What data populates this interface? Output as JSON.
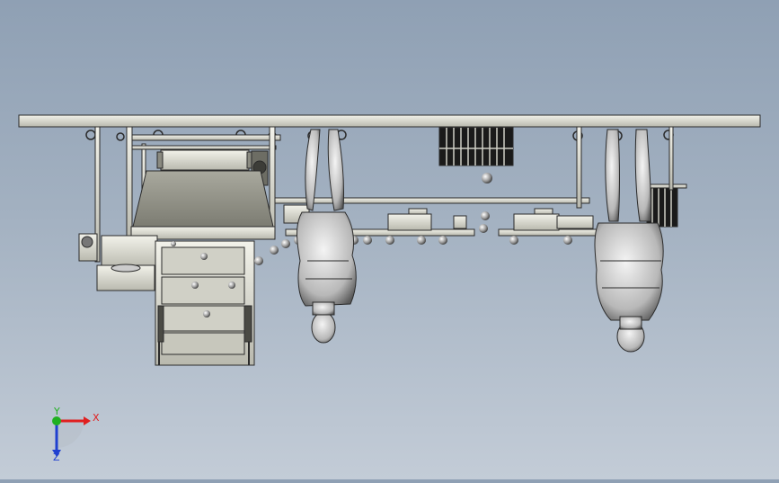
{
  "viewport": {
    "background_top": "#8fa0b4",
    "background_bottom": "#c3ccd7",
    "part_fill": "#d9d9cf",
    "part_stroke": "#2b2b2b"
  },
  "triad": {
    "x_label": "X",
    "y_label": "Y",
    "z_label": "Z",
    "x_color": "#e02020",
    "y_color": "#20b020",
    "z_color": "#2040d0"
  },
  "icons": {
    "triad": "axis-triad-icon"
  }
}
